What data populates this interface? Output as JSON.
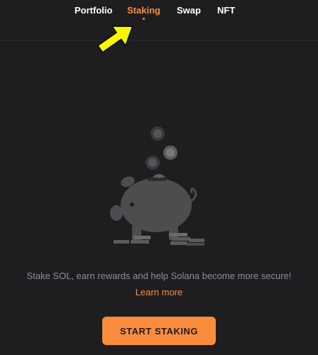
{
  "nav": {
    "tabs": [
      {
        "label": "Portfolio",
        "active": false
      },
      {
        "label": "Staking",
        "active": true
      },
      {
        "label": "Swap",
        "active": false
      },
      {
        "label": "NFT",
        "active": false
      }
    ]
  },
  "annotation": {
    "icon": "arrow-icon",
    "color": "#f7f700"
  },
  "illustration": {
    "icon": "piggy-bank-icon"
  },
  "content": {
    "tagline": "Stake SOL, earn rewards and help Solana become more secure!",
    "learn_more": "Learn more",
    "start_button": "START STAKING"
  },
  "colors": {
    "background": "#1e1e21",
    "accent": "#fb8c3c",
    "muted_text": "#8e8e93"
  }
}
